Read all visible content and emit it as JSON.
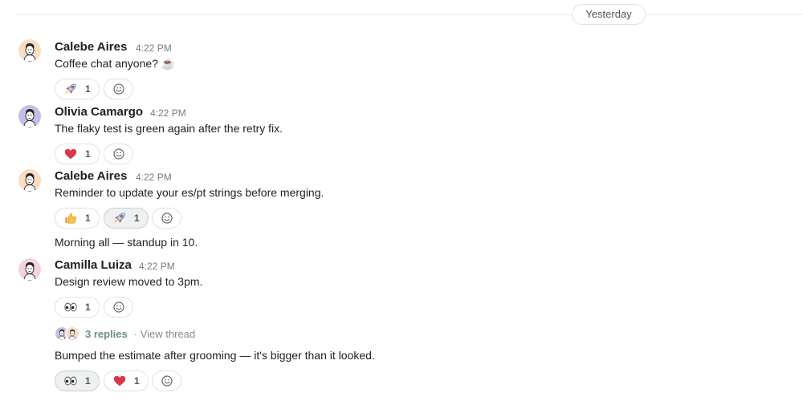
{
  "date_divider": "Yesterday",
  "messages": [
    {
      "author": "Calebe Aires",
      "time": "4:22 PM",
      "text": "Coffee chat anyone? ☕",
      "reactions": [
        {
          "emoji": "rocket-icon",
          "count": "1",
          "active": false
        }
      ]
    },
    {
      "author": "Olivia Camargo",
      "time": "4:22 PM",
      "text": "The flaky test is green again after the retry fix.",
      "reactions": [
        {
          "emoji": "heart-icon",
          "count": "1",
          "active": false
        }
      ]
    },
    {
      "author": "Calebe Aires",
      "time": "4:22 PM",
      "text": "Reminder to update your es/pt strings before merging.",
      "reactions": [
        {
          "emoji": "thumbs-up-icon",
          "count": "1",
          "active": false
        },
        {
          "emoji": "rocket-icon",
          "count": "1",
          "active": true
        }
      ]
    },
    {
      "continuation": true,
      "text": "Morning all — standup in 10."
    },
    {
      "author": "Camilla Luiza",
      "time": "4:22 PM",
      "text": "Design review moved to 3pm.",
      "reactions": [
        {
          "emoji": "eyes-icon",
          "count": "1",
          "active": false
        }
      ],
      "thread": {
        "replies": "3 replies",
        "view": "· View thread"
      }
    },
    {
      "continuation": true,
      "text": "Bumped the estimate after grooming — it's bigger than it looked.",
      "reactions": [
        {
          "emoji": "eyes-icon",
          "count": "1",
          "active": true
        },
        {
          "emoji": "heart-icon",
          "count": "1",
          "active": false
        }
      ]
    }
  ],
  "colors": {
    "avatar_peach": "#f9ddc3",
    "avatar_purple": "#c8bde8",
    "avatar_pink": "#f7d2da",
    "reply_link": "#6f8f79"
  }
}
